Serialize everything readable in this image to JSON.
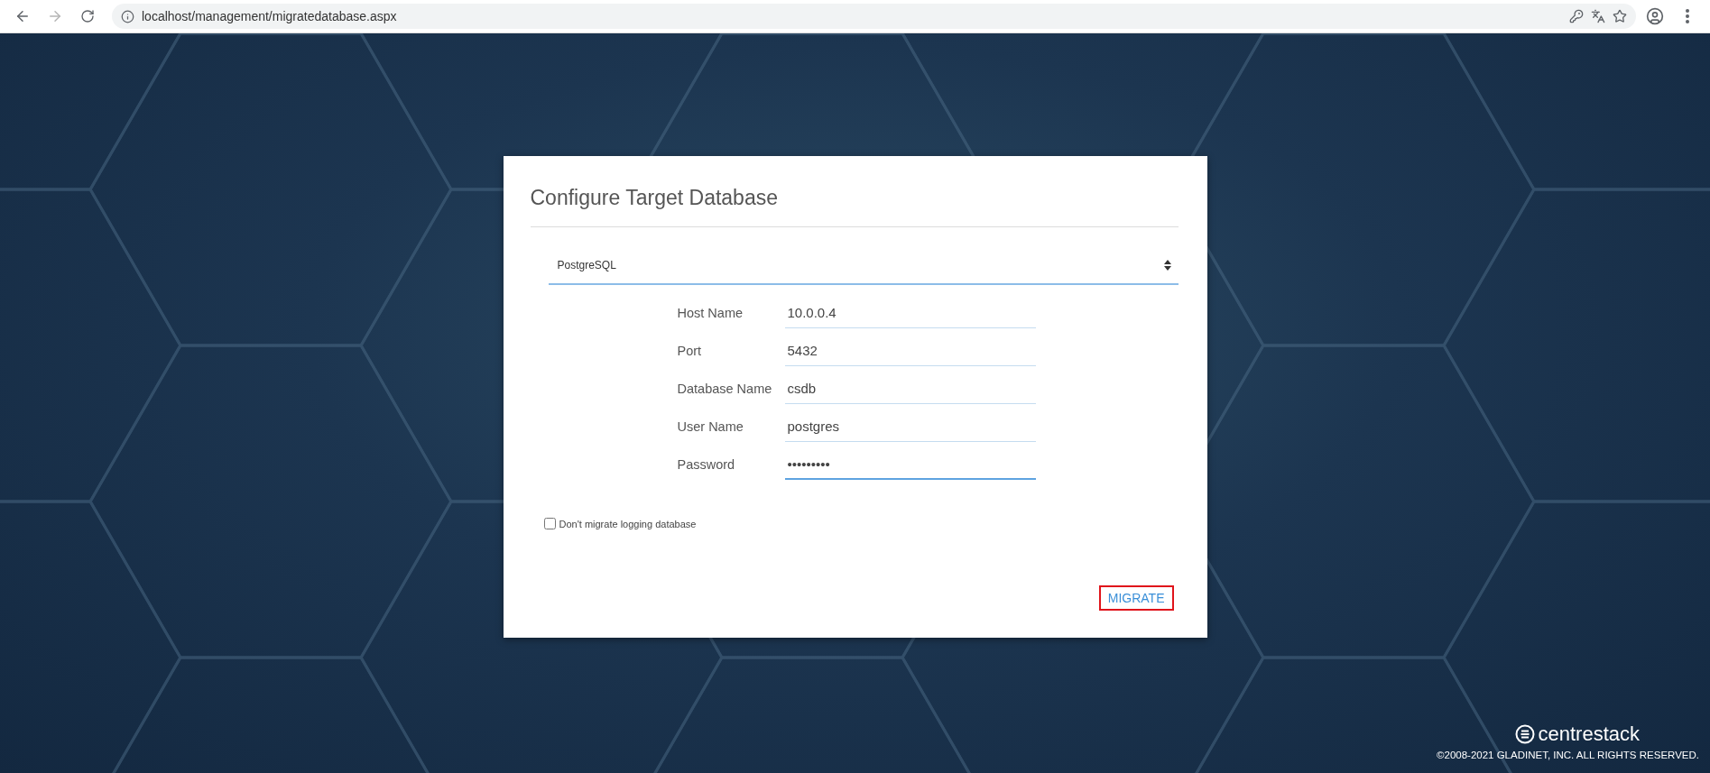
{
  "browser": {
    "url": "localhost/management/migratedatabase.aspx",
    "forward_disabled": true
  },
  "dialog": {
    "title": "Configure Target Database",
    "database_type": "PostgreSQL",
    "fields": [
      {
        "label": "Host Name",
        "value": "10.0.0.4",
        "focused": false
      },
      {
        "label": "Port",
        "value": "5432",
        "focused": false
      },
      {
        "label": "Database Name",
        "value": "csdb",
        "focused": false
      },
      {
        "label": "User Name",
        "value": "postgres",
        "focused": false
      },
      {
        "label": "Password",
        "value": "•••••••••",
        "focused": true
      }
    ],
    "checkbox": {
      "label": "Don't migrate logging database",
      "checked": false
    },
    "button": {
      "label": "MIGRATE",
      "highlighted": true
    }
  },
  "footer": {
    "logo": "centre**stack**",
    "copyright": "©2008-2021 GLADINET, INC. ALL RIGHTS RESERVED."
  }
}
